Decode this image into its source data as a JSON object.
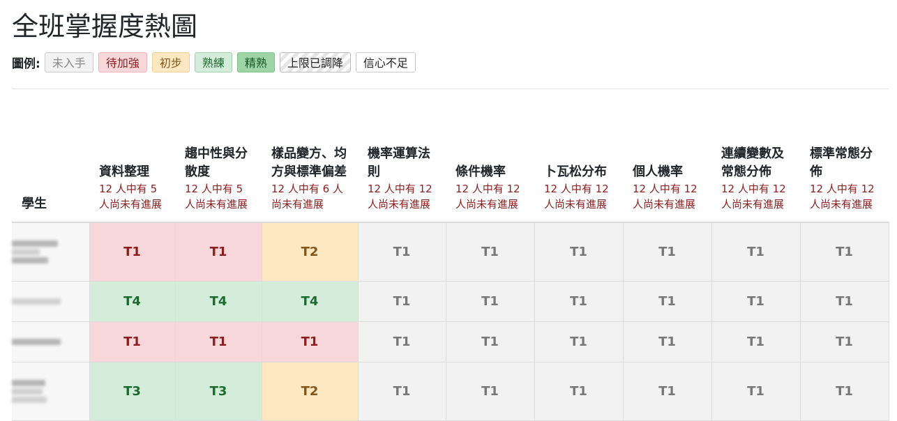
{
  "page": {
    "title": "全班掌握度熱圖"
  },
  "legend": {
    "label": "圖例:",
    "items": [
      {
        "label": "未入手",
        "color": "#f2f2f2"
      },
      {
        "label": "待加強",
        "color": "#f8d7da"
      },
      {
        "label": "初步",
        "color": "#fde8c2"
      },
      {
        "label": "熟練",
        "color": "#d4edda"
      },
      {
        "label": "精熟",
        "color": "#9fd4a7"
      },
      {
        "label": "上限已調降",
        "color": "#e5e5e5"
      },
      {
        "label": "信心不足",
        "color": "#ffffff"
      }
    ]
  },
  "table": {
    "student_header": "學生",
    "columns": [
      {
        "name": "資料整理",
        "status": "12 人中有 5 人尚未有進展"
      },
      {
        "name": "趨中性與分散度",
        "status": "12 人中有 5 人尚未有進展"
      },
      {
        "name": "樣品變方、均方與標準偏差",
        "status": "12 人中有 6 人尚未有進展"
      },
      {
        "name": "機率運算法則",
        "status": "12 人中有 12 人尚未有進展"
      },
      {
        "name": "條件機率",
        "status": "12 人中有 12 人尚未有進展"
      },
      {
        "name": "卜瓦松分布",
        "status": "12 人中有 12 人尚未有進展"
      },
      {
        "name": "個人機率",
        "status": "12 人中有 12 人尚未有進展"
      },
      {
        "name": "連續變數及常態分佈",
        "status": "12 人中有 12 人尚未有進展"
      },
      {
        "name": "標準常態分佈",
        "status": "12 人中有 12 人尚未有進展"
      }
    ],
    "rows": [
      {
        "cells": [
          "T1",
          "T1",
          "T2",
          "T1",
          "T1",
          "T1",
          "T1",
          "T1",
          "T1"
        ],
        "levels": [
          "weak",
          "weak",
          "begin",
          "none",
          "none",
          "none",
          "none",
          "none",
          "none"
        ]
      },
      {
        "cells": [
          "T4",
          "T4",
          "T4",
          "T1",
          "T1",
          "T1",
          "T1",
          "T1",
          "T1"
        ],
        "levels": [
          "skilled",
          "skilled",
          "skilled",
          "none",
          "none",
          "none",
          "none",
          "none",
          "none"
        ]
      },
      {
        "cells": [
          "T1",
          "T1",
          "T1",
          "T1",
          "T1",
          "T1",
          "T1",
          "T1",
          "T1"
        ],
        "levels": [
          "weak",
          "weak",
          "weak",
          "none",
          "none",
          "none",
          "none",
          "none",
          "none"
        ]
      },
      {
        "cells": [
          "T3",
          "T3",
          "T2",
          "T1",
          "T1",
          "T1",
          "T1",
          "T1",
          "T1"
        ],
        "levels": [
          "skilled",
          "skilled",
          "begin",
          "none",
          "none",
          "none",
          "none",
          "none",
          "none"
        ]
      }
    ]
  },
  "colors": {
    "weak": "#f8d7da",
    "begin": "#fde8c2",
    "skilled": "#d4edda",
    "none": "#f2f2f2",
    "weak_text": "#8b1f1f",
    "begin_text": "#85561c",
    "skilled_text": "#1c6b2e",
    "none_text": "#777777"
  }
}
